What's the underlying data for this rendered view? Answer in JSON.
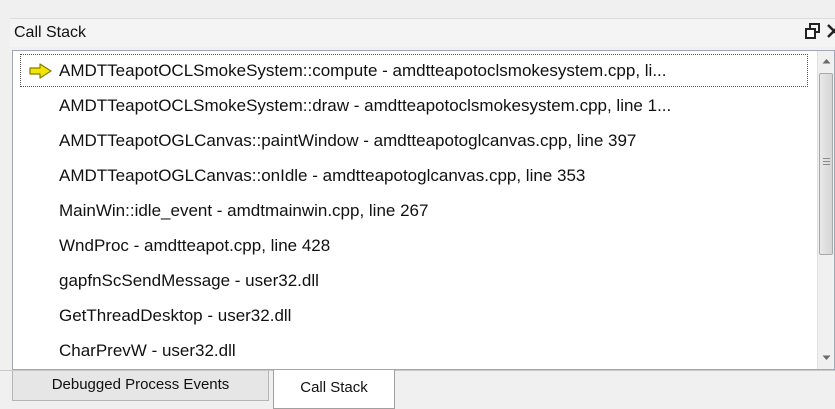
{
  "window": {
    "title": "Call Stack",
    "float_glyph": "🗗",
    "close_glyph": "✕"
  },
  "colors": {
    "current_frame_arrow": "#f2e600",
    "list_border": "#9fa9b5",
    "panel_bg": "#f0f0f0"
  },
  "frames": [
    {
      "text": "AMDTTeapotOCLSmokeSystem::compute - amdtteapotoclsmokesystem.cpp, li...",
      "current": true
    },
    {
      "text": "AMDTTeapotOCLSmokeSystem::draw - amdtteapotoclsmokesystem.cpp, line 1..."
    },
    {
      "text": "AMDTTeapotOGLCanvas::paintWindow - amdtteapotoglcanvas.cpp, line 397"
    },
    {
      "text": "AMDTTeapotOGLCanvas::onIdle - amdtteapotoglcanvas.cpp, line 353"
    },
    {
      "text": "MainWin::idle_event - amdtmainwin.cpp, line 267"
    },
    {
      "text": "WndProc - amdtteapot.cpp, line 428"
    },
    {
      "text": "gapfnScSendMessage - user32.dll"
    },
    {
      "text": "GetThreadDesktop - user32.dll"
    },
    {
      "text": "CharPrevW - user32.dll"
    }
  ],
  "icons": {
    "current_frame": "yellow-arrow-icon",
    "scroll_up": "up-arrow",
    "scroll_down": "down-arrow"
  },
  "tabs": [
    {
      "label": "Debugged Process Events",
      "active": false
    },
    {
      "label": "Call Stack",
      "active": true
    }
  ]
}
